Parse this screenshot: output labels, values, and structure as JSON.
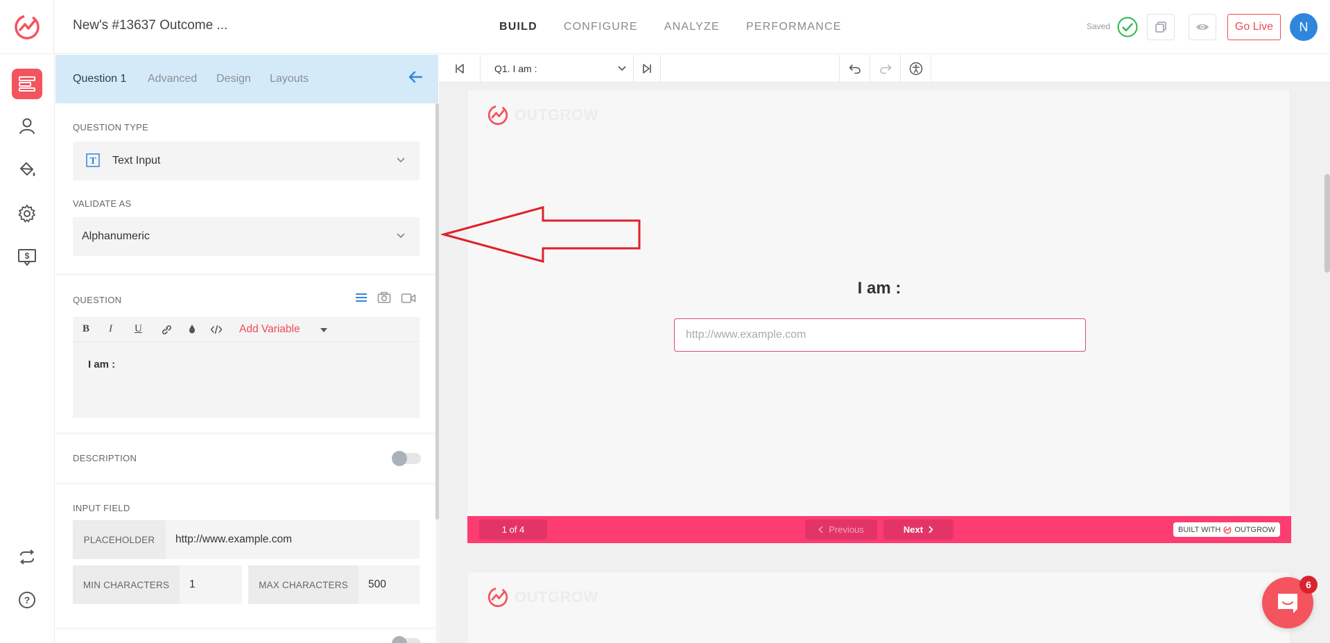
{
  "header": {
    "doc_title": "New's #13637 Outcome ...",
    "nav": [
      "BUILD",
      "CONFIGURE",
      "ANALYZE",
      "PERFORMANCE"
    ],
    "saved_label": "Saved",
    "go_live_label": "Go Live",
    "avatar_initial": "N"
  },
  "panel": {
    "tabs": [
      "Question 1",
      "Advanced",
      "Design",
      "Layouts"
    ],
    "question_type_label": "QUESTION TYPE",
    "question_type_value": "Text Input",
    "validate_label": "VALIDATE AS",
    "validate_value": "Alphanumeric",
    "question_label": "QUESTION",
    "rte_buttons": [
      "B",
      "I",
      "U"
    ],
    "add_variable_label": "Add Variable",
    "question_text": "I am :",
    "description_label": "DESCRIPTION",
    "input_field_label": "INPUT FIELD",
    "placeholder_label": "PLACEHOLDER",
    "placeholder_value": "http://www.example.com",
    "min_chars_label": "MIN CHARACTERS",
    "min_chars_value": "1",
    "max_chars_label": "MAX CHARACTERS",
    "max_chars_value": "500"
  },
  "editor": {
    "question_select": "Q1. I am :",
    "card_logo_word": "OUTGROW",
    "question_title": "I am :",
    "input_placeholder": "http://www.example.com",
    "page_count": "1 of 4",
    "prev_label": "Previous",
    "next_label": "Next",
    "built_with": "BUILT WITH",
    "built_brand": "OUTGROW"
  },
  "chat": {
    "badge_count": "6"
  },
  "colors": {
    "brand": "#f4545e",
    "footer": "#fd3c72",
    "tab_bg": "#d5eaf8",
    "saved_check": "#2ab84a",
    "annotation_arrow": "#e0202a"
  }
}
